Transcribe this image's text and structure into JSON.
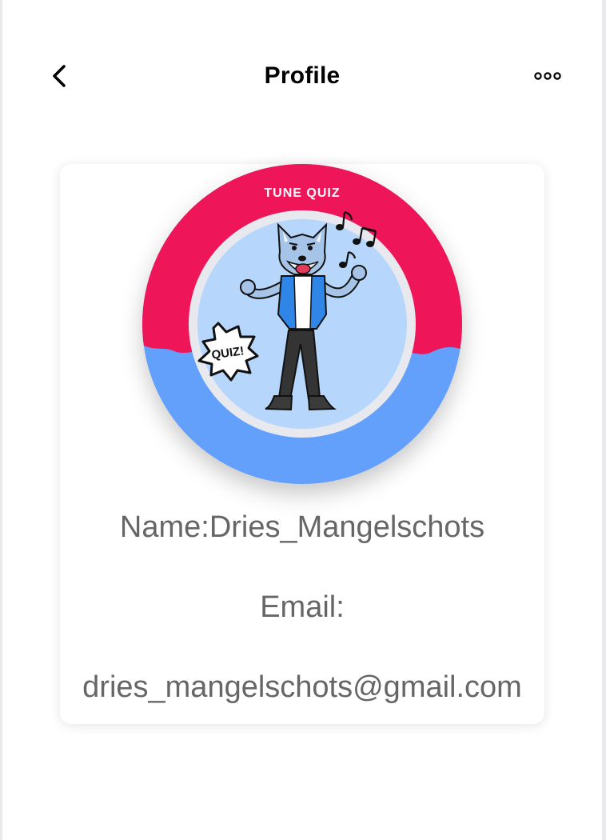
{
  "header": {
    "title": "Profile",
    "back_icon": "chevron-left-icon",
    "menu_icon": "more-horizontal-icon"
  },
  "logo": {
    "brand_text": "TUNE QUIZ",
    "badge_text": "QUIZ!",
    "colors": {
      "top_ring": "#ee1558",
      "bottom_ring": "#62a0fc",
      "inner_circle": "#b7d6fb",
      "inner_border": "#e7e9ef"
    }
  },
  "profile": {
    "name_label": "Name:",
    "name_value": "Dries_Mangelschots",
    "email_label": "Email:",
    "email_value": "dries_mangelschots@gmail.com"
  }
}
